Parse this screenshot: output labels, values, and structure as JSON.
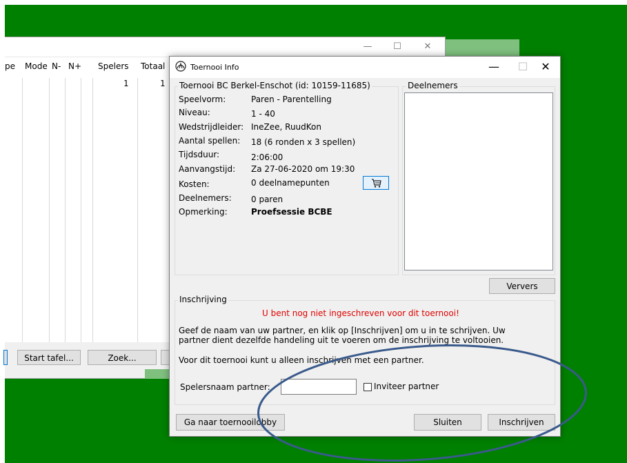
{
  "background_window": {
    "columns": [
      "pe",
      "Mode",
      "N-",
      "N+",
      "Spelers",
      "Totaal"
    ],
    "row": {
      "spelers": "1",
      "totaal": "1"
    },
    "buttons": {
      "start_tafel": "Start tafel...",
      "zoek": "Zoek..."
    },
    "controls": {
      "minimize": "—",
      "maximize": "☐",
      "close": "✕"
    }
  },
  "dialog": {
    "title": "Toernooi Info",
    "controls": {
      "minimize": "—",
      "maximize": "☐",
      "close": "✕"
    },
    "info": {
      "header": "Toernooi BC Berkel-Enschot (id: 10159-11685)",
      "fields": [
        {
          "label": "Speelvorm:",
          "value": "Paren - Parentelling"
        },
        {
          "label": "Niveau:",
          "value": "1 - 40"
        },
        {
          "label": "Wedstrijdleider:",
          "value": "IneZee, RuudKon"
        },
        {
          "label": "Aantal spellen:",
          "value": "18 (6 ronden x 3 spellen)"
        },
        {
          "label": "Tijdsduur:",
          "value": "2:06:00"
        },
        {
          "label": "Aanvangstijd:",
          "value": "Za 27-06-2020 om 19:30"
        },
        {
          "label": "Kosten:",
          "value": "0 deelnamepunten"
        },
        {
          "label": "Deelnemers:",
          "value": "0 paren"
        },
        {
          "label": "Opmerking:",
          "value": "Proefsessie BCBE"
        }
      ]
    },
    "deelnemers": {
      "legend": "Deelnemers",
      "refresh_button": "Ververs"
    },
    "inschrijving": {
      "legend": "Inschrijving",
      "warning": "U bent nog niet ingeschreven voor dit toernooi!",
      "instructions_line1": "Geef de naam van uw partner, en klik op [Inschrijven] om u in te schrijven. Uw",
      "instructions_line2": "partner dient dezelfde handeling uit te voeren om de inschrijving te voltooien.",
      "partner_only": "Voor dit toernooi kunt u alleen inschrijven met een partner.",
      "partner_label": "Spelersnaam partner:",
      "partner_value": "",
      "invite_label": "Inviteer partner",
      "invite_checked": false
    },
    "buttons": {
      "lobby": "Ga naar toernooilobby",
      "close": "Sluiten",
      "register": "Inschrijven"
    }
  },
  "colors": {
    "desktop": "#008000",
    "warning": "#e00000",
    "annotation": "#3a5a8c"
  }
}
